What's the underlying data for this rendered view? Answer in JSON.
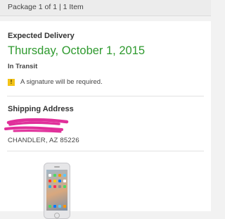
{
  "package_header": {
    "title": "Package 1 of 1 | 1 Item"
  },
  "delivery": {
    "heading": "Expected Delivery",
    "date": "Thursday, October 1, 2015",
    "status": "In Transit",
    "signature_icon": "!",
    "signature_note": "A signature will be required.",
    "date_color": "#2f9a2f"
  },
  "shipping": {
    "heading": "Shipping Address",
    "city_line": "CHANDLER, AZ 85226"
  },
  "product": {
    "image_icon": "phone-icon"
  }
}
